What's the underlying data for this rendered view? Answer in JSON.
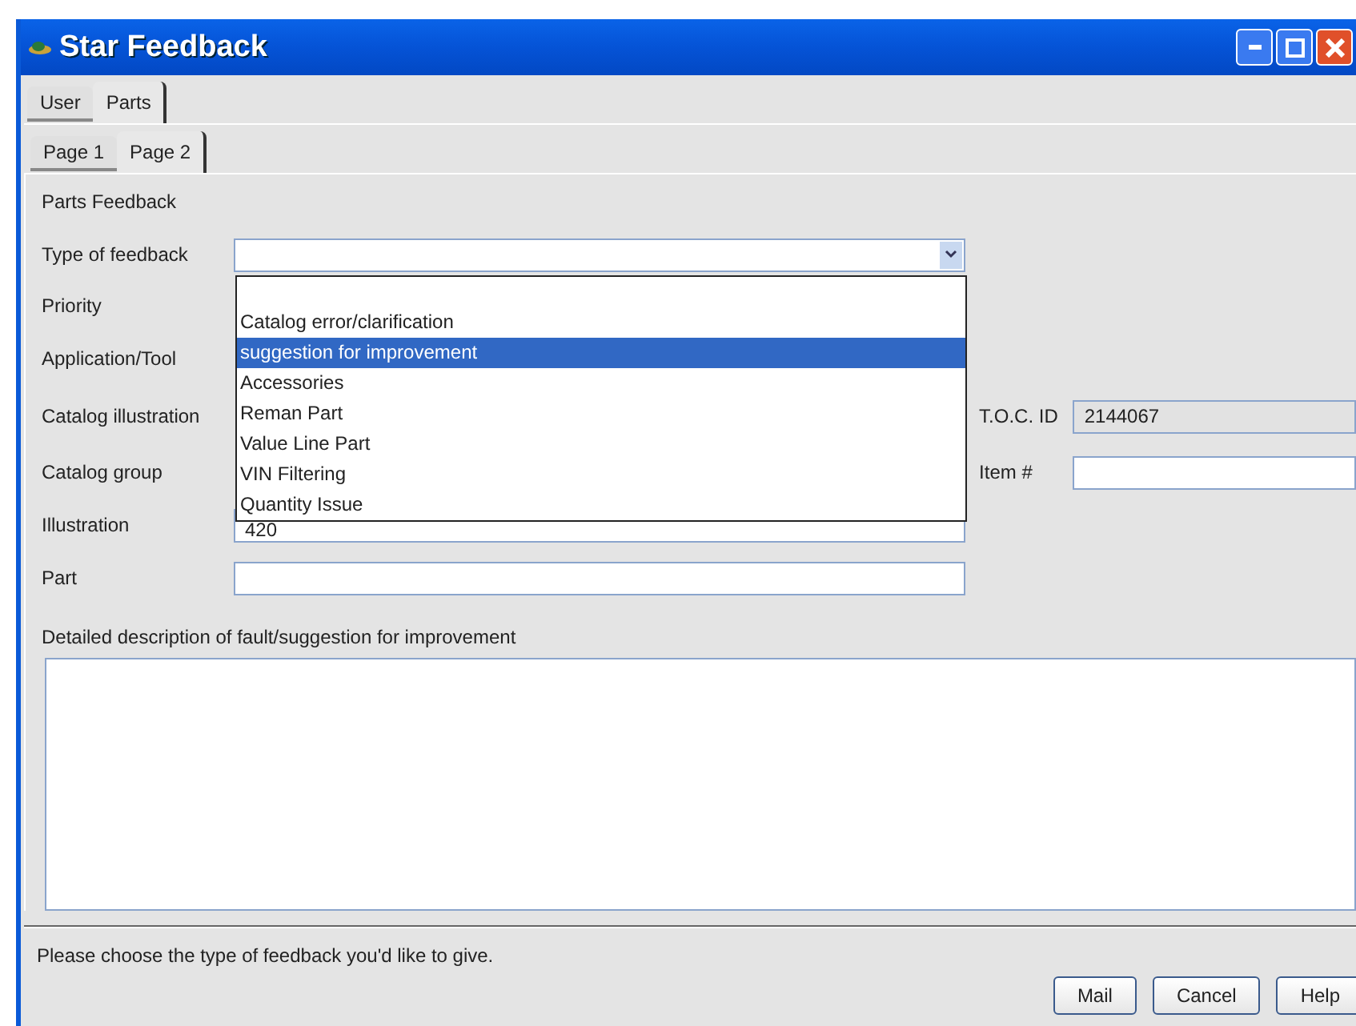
{
  "window": {
    "title": "Star Feedback"
  },
  "tabs": [
    {
      "label": "User",
      "selected": false
    },
    {
      "label": "Parts",
      "selected": true
    }
  ],
  "page_tabs": [
    {
      "label": "Page 1",
      "selected": false
    },
    {
      "label": "Page 2",
      "selected": true
    }
  ],
  "section_title": "Parts Feedback",
  "labels": {
    "type": "Type of feedback",
    "priority": "Priority",
    "application": "Application/Tool",
    "catalog_illustration": "Catalog illustration",
    "catalog_group": "Catalog group",
    "illustration": "Illustration",
    "part": "Part",
    "toc_id": "T.O.C. ID",
    "item": "Item #"
  },
  "fields": {
    "toc_id": "2144067",
    "illustration": "420"
  },
  "dropdown_options": [
    {
      "label": "Catalog error/clarification",
      "selected": false
    },
    {
      "label": "suggestion for improvement",
      "selected": true
    },
    {
      "label": "Accessories",
      "selected": false
    },
    {
      "label": "Reman Part",
      "selected": false
    },
    {
      "label": "Value Line Part",
      "selected": false
    },
    {
      "label": "VIN Filtering",
      "selected": false
    },
    {
      "label": "Quantity Issue",
      "selected": false
    }
  ],
  "description_label": "Detailed description of fault/suggestion for improvement",
  "status_bar": "Please choose the type of feedback you'd like to give.",
  "buttons": [
    "Mail",
    "Cancel",
    "Help"
  ]
}
